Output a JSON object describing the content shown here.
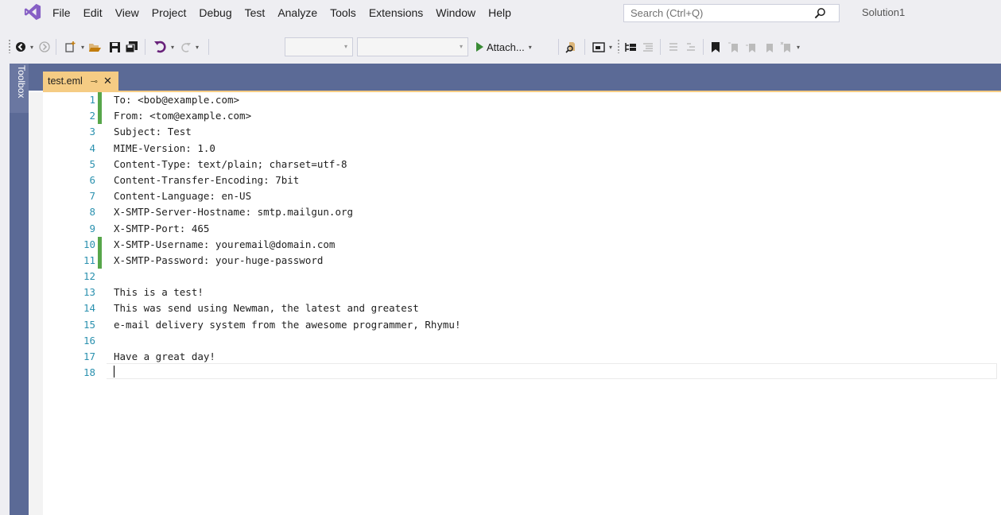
{
  "menubar": {
    "items": [
      "File",
      "Edit",
      "View",
      "Project",
      "Debug",
      "Test",
      "Analyze",
      "Tools",
      "Extensions",
      "Window",
      "Help"
    ],
    "search_placeholder": "Search (Ctrl+Q)",
    "solution_name": "Solution1"
  },
  "toolbar": {
    "attach_label": "Attach..."
  },
  "sidebar": {
    "toolbox_label": "Toolbox"
  },
  "tabs": [
    {
      "label": "test.eml",
      "active": true
    }
  ],
  "editor": {
    "lines": [
      {
        "number": "1",
        "text": "To: <bob@example.com>",
        "changed": true
      },
      {
        "number": "2",
        "text": "From: <tom@example.com>",
        "changed": true
      },
      {
        "number": "3",
        "text": "Subject: Test",
        "changed": false
      },
      {
        "number": "4",
        "text": "MIME-Version: 1.0",
        "changed": false
      },
      {
        "number": "5",
        "text": "Content-Type: text/plain; charset=utf-8",
        "changed": false
      },
      {
        "number": "6",
        "text": "Content-Transfer-Encoding: 7bit",
        "changed": false
      },
      {
        "number": "7",
        "text": "Content-Language: en-US",
        "changed": false
      },
      {
        "number": "8",
        "text": "X-SMTP-Server-Hostname: smtp.mailgun.org",
        "changed": false
      },
      {
        "number": "9",
        "text": "X-SMTP-Port: 465",
        "changed": false
      },
      {
        "number": "10",
        "text": "X-SMTP-Username: youremail@domain.com",
        "changed": true
      },
      {
        "number": "11",
        "text": "X-SMTP-Password: your-huge-password",
        "changed": true
      },
      {
        "number": "12",
        "text": "",
        "changed": false
      },
      {
        "number": "13",
        "text": "This is a test!",
        "changed": false
      },
      {
        "number": "14",
        "text": "This was send using Newman, the latest and greatest",
        "changed": false
      },
      {
        "number": "15",
        "text": "e-mail delivery system from the awesome programmer, Rhymu!",
        "changed": false
      },
      {
        "number": "16",
        "text": "",
        "changed": false
      },
      {
        "number": "17",
        "text": "Have a great day!",
        "changed": false
      },
      {
        "number": "18",
        "text": "",
        "changed": false
      }
    ]
  },
  "colors": {
    "accent_vs": "#68217a",
    "tab_active": "#f5cc84",
    "dock_blue": "#5b6a96",
    "line_number": "#2b91af",
    "saved_change": "#57a64a"
  }
}
